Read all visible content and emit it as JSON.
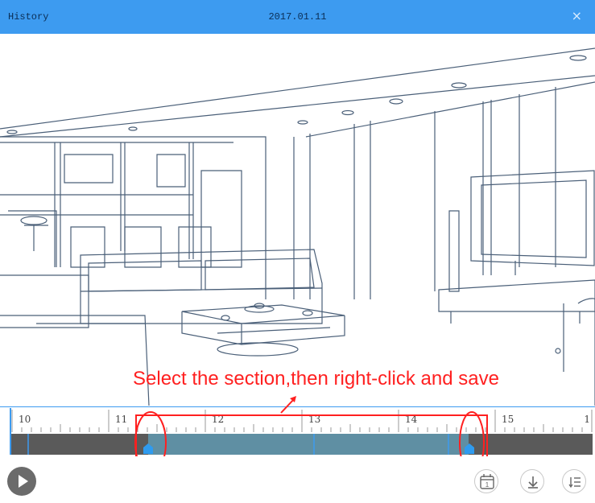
{
  "window": {
    "title": "History",
    "date": "2017.01.11",
    "close_symbol": "×"
  },
  "annotation": {
    "text": "Select the section,then right-click and save",
    "color": "#ff2020"
  },
  "timeline": {
    "tick_labels": [
      "10",
      "11",
      "12",
      "13",
      "14",
      "15",
      "1"
    ],
    "selection_start_fraction": 0.23,
    "selection_end_fraction": 0.805
  },
  "controls": {
    "play": "play-icon",
    "calendar": "calendar-icon",
    "calendar_day": "1",
    "download": "download-icon",
    "list": "list-icon"
  },
  "colors": {
    "titlebar": "#3d9bf0",
    "track_dark": "#5a5a5a",
    "track_selected": "#5f8fa3",
    "handle": "#2f9bef",
    "annotation": "#ff2020"
  }
}
